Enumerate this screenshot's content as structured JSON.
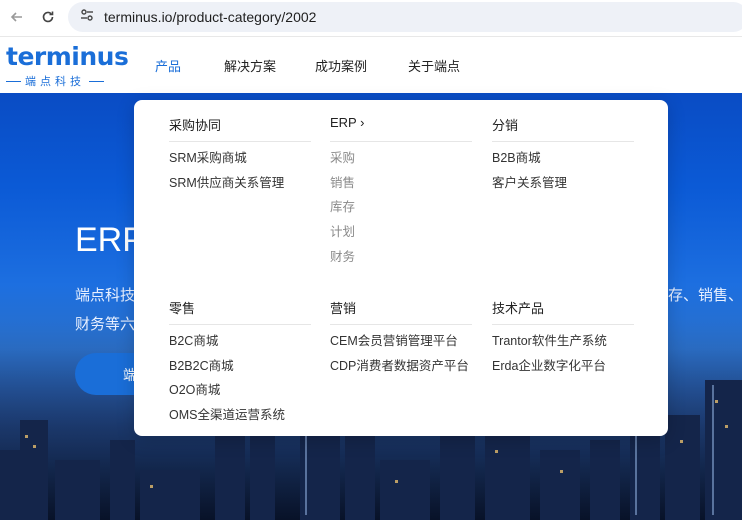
{
  "browser": {
    "url": "terminus.io/product-category/2002"
  },
  "header": {
    "logo_main": "terminus",
    "logo_sub": "端点科技",
    "nav": [
      "产品",
      "解决方案",
      "成功案例",
      "关于端点"
    ]
  },
  "hero": {
    "title": "ERP",
    "desc_line1": "端点科技",
    "desc_line2": "财务等六",
    "desc_right": "存、销售、",
    "button_label": "端"
  },
  "dropdown": {
    "columns": [
      {
        "heading": "采购协同",
        "items": [
          "SRM采购商城",
          "SRM供应商关系管理"
        ]
      },
      {
        "heading": "ERP ›",
        "items": [
          "采购",
          "销售",
          "库存",
          "计划",
          "财务"
        ]
      },
      {
        "heading": "分销",
        "items": [
          "B2B商城",
          "客户关系管理"
        ]
      },
      {
        "heading": "零售",
        "items": [
          "B2C商城",
          "B2B2C商城",
          "O2O商城",
          "OMS全渠道运营系统"
        ]
      },
      {
        "heading": "营销",
        "items": [
          "CEM会员营销管理平台",
          "CDP消费者数据资产平台"
        ]
      },
      {
        "heading": "技术产品",
        "items": [
          "Trantor软件生产系统",
          "Erda企业数字化平台"
        ]
      }
    ]
  },
  "colors": {
    "brand": "#1a6ed8",
    "hero_top": "#0a4cc4"
  },
  "icons": [
    "back-arrow-icon",
    "reload-icon",
    "site-info-icon"
  ]
}
